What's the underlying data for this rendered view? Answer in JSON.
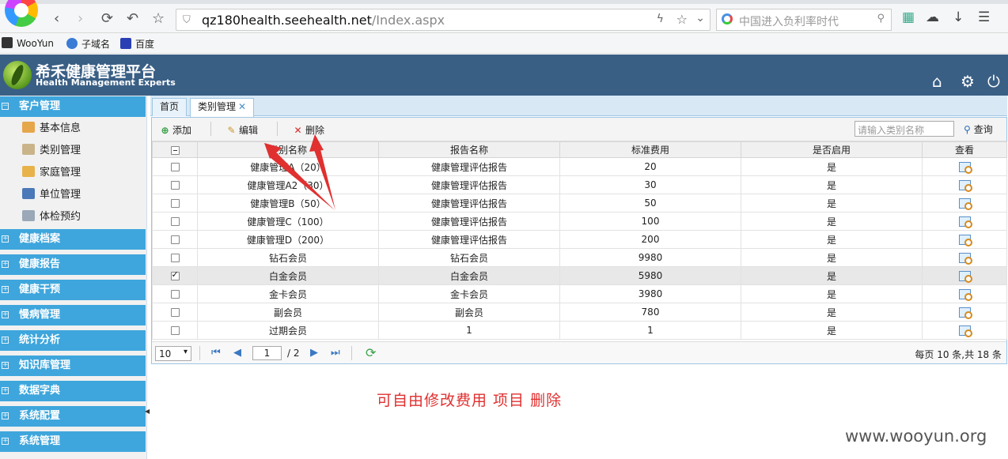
{
  "browser": {
    "back": "‹",
    "forward": "›",
    "reload": "⟳",
    "undo": "↶",
    "star": "☆",
    "url_host": "qz180health.seehealth.net",
    "url_path": "/Index.aspx",
    "search_placeholder": "中国进入负利率时代",
    "bookmarks": [
      "WooYun",
      "子域名",
      "百度"
    ]
  },
  "app": {
    "title": "希禾健康管理平台",
    "subtitle": "Health Management Experts"
  },
  "sidebar": {
    "groups": [
      {
        "label": "客户管理",
        "expanded": true
      },
      {
        "label": "健康档案"
      },
      {
        "label": "健康报告"
      },
      {
        "label": "健康干预"
      },
      {
        "label": "慢病管理"
      },
      {
        "label": "统计分析"
      },
      {
        "label": "知识库管理"
      },
      {
        "label": "数据字典"
      },
      {
        "label": "系统配置"
      },
      {
        "label": "系统管理"
      }
    ],
    "subitems": [
      "基本信息",
      "类别管理",
      "家庭管理",
      "单位管理",
      "体检预约"
    ]
  },
  "tabs": [
    {
      "label": "首页"
    },
    {
      "label": "类别管理",
      "close": "✕"
    }
  ],
  "toolbar": {
    "add": "添加",
    "edit": "编辑",
    "delete": "删除",
    "search_placeholder": "请输入类别名称",
    "query": "查询"
  },
  "table": {
    "columns": [
      "类别名称",
      "报告名称",
      "标准费用",
      "是否启用",
      "查看"
    ],
    "rows": [
      {
        "name": "健康管理A（20）",
        "report": "健康管理评估报告",
        "fee": "20",
        "enabled": "是",
        "checked": false
      },
      {
        "name": "健康管理A2（30）",
        "report": "健康管理评估报告",
        "fee": "30",
        "enabled": "是",
        "checked": false
      },
      {
        "name": "健康管理B（50）",
        "report": "健康管理评估报告",
        "fee": "50",
        "enabled": "是",
        "checked": false
      },
      {
        "name": "健康管理C（100）",
        "report": "健康管理评估报告",
        "fee": "100",
        "enabled": "是",
        "checked": false
      },
      {
        "name": "健康管理D（200）",
        "report": "健康管理评估报告",
        "fee": "200",
        "enabled": "是",
        "checked": false
      },
      {
        "name": "钻石会员",
        "report": "钻石会员",
        "fee": "9980",
        "enabled": "是",
        "checked": false
      },
      {
        "name": "白金会员",
        "report": "白金会员",
        "fee": "5980",
        "enabled": "是",
        "checked": true
      },
      {
        "name": "金卡会员",
        "report": "金卡会员",
        "fee": "3980",
        "enabled": "是",
        "checked": false
      },
      {
        "name": "副会员",
        "report": "副会员",
        "fee": "780",
        "enabled": "是",
        "checked": false
      },
      {
        "name": "过期会员",
        "report": "1",
        "fee": "1",
        "enabled": "是",
        "checked": false
      }
    ]
  },
  "pager": {
    "page_size": "10",
    "page": "1",
    "total_pages": "/ 2",
    "info": "每页 10 条,共 18 条"
  },
  "annotation": "可自由修改费用 项目 删除",
  "watermark": "www.wooyun.org",
  "colors": {
    "header": "#3a5f85",
    "sidebar_group": "#3ea6dc",
    "annotation": "#e03030"
  }
}
